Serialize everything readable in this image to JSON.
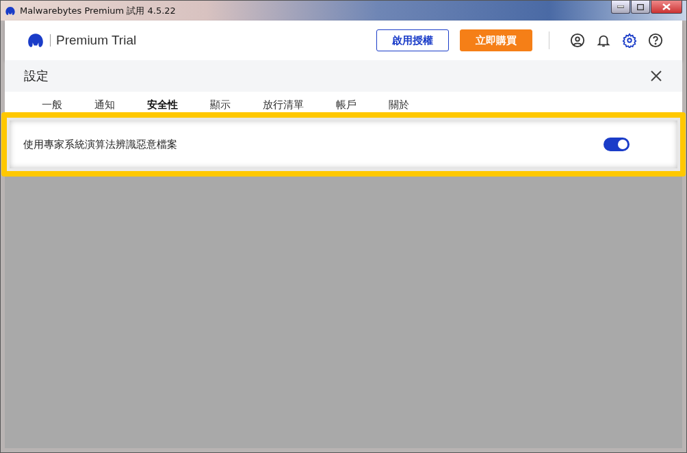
{
  "window": {
    "title": "Malwarebytes Premium 試用  4.5.22"
  },
  "header": {
    "product": "Premium Trial",
    "buttons": [
      {
        "label": "啟用授權",
        "kind": "outline"
      },
      {
        "label": "立即購買",
        "kind": "primary"
      }
    ],
    "icons": [
      {
        "kind": "account",
        "selected": false
      },
      {
        "kind": "bell",
        "selected": false
      },
      {
        "kind": "gear",
        "selected": true
      },
      {
        "kind": "help",
        "selected": false
      }
    ]
  },
  "settings": {
    "title": "設定",
    "tabs": [
      {
        "label": "一般",
        "selected": false
      },
      {
        "label": "通知",
        "selected": false
      },
      {
        "label": "安全性",
        "selected": true
      },
      {
        "label": "顯示",
        "selected": false
      },
      {
        "label": "放行清單",
        "selected": false
      },
      {
        "label": "帳戶",
        "selected": false
      },
      {
        "label": "關於",
        "selected": false
      }
    ]
  },
  "highlighted_setting": {
    "label": "使用專家系統演算法辨識惡意檔案",
    "on": true
  }
}
